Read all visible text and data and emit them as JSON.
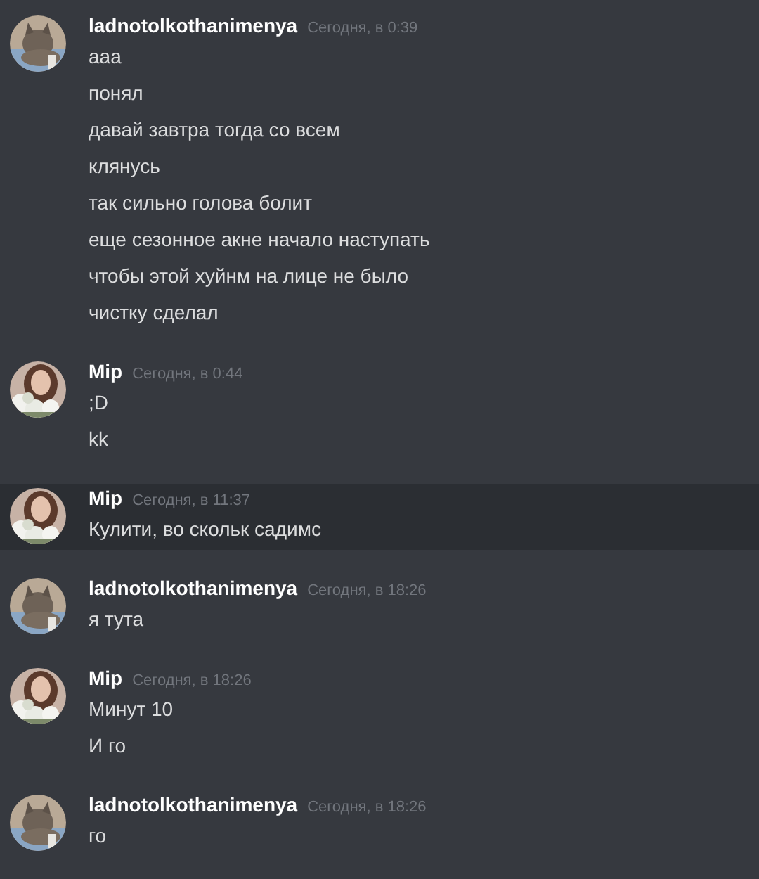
{
  "groups": [
    {
      "author": "ladnotolkothanimenya",
      "timestamp": "Сегодня, в 0:39",
      "hovered": false,
      "avatar": {
        "kind": "picture"
      },
      "messages": [
        "ааа",
        "понял",
        "давай завтра тогда со всем",
        "клянусь",
        "так сильно голова болит",
        "еще сезонное акне начало наступать",
        "чтобы этой хуйнм на лице не было",
        "чистку сделал"
      ]
    },
    {
      "author": "Mip",
      "timestamp": "Сегодня, в 0:44",
      "hovered": false,
      "avatar": {
        "kind": "picture"
      },
      "messages": [
        ";D",
        "kk"
      ]
    },
    {
      "author": "Mip",
      "timestamp": "Сегодня, в 11:37",
      "hovered": true,
      "avatar": {
        "kind": "picture"
      },
      "messages": [
        "Кулити, во скольк садимс"
      ]
    },
    {
      "author": "ladnotolkothanimenya",
      "timestamp": "Сегодня, в 18:26",
      "hovered": false,
      "avatar": {
        "kind": "picture"
      },
      "messages": [
        "я тута"
      ]
    },
    {
      "author": "Mip",
      "timestamp": "Сегодня, в 18:26",
      "hovered": false,
      "avatar": {
        "kind": "picture"
      },
      "messages": [
        "Минут 10",
        "И го"
      ]
    },
    {
      "author": "ladnotolkothanimenya",
      "timestamp": "Сегодня, в 18:26",
      "hovered": false,
      "avatar": {
        "kind": "picture"
      },
      "messages": [
        "го"
      ]
    }
  ]
}
